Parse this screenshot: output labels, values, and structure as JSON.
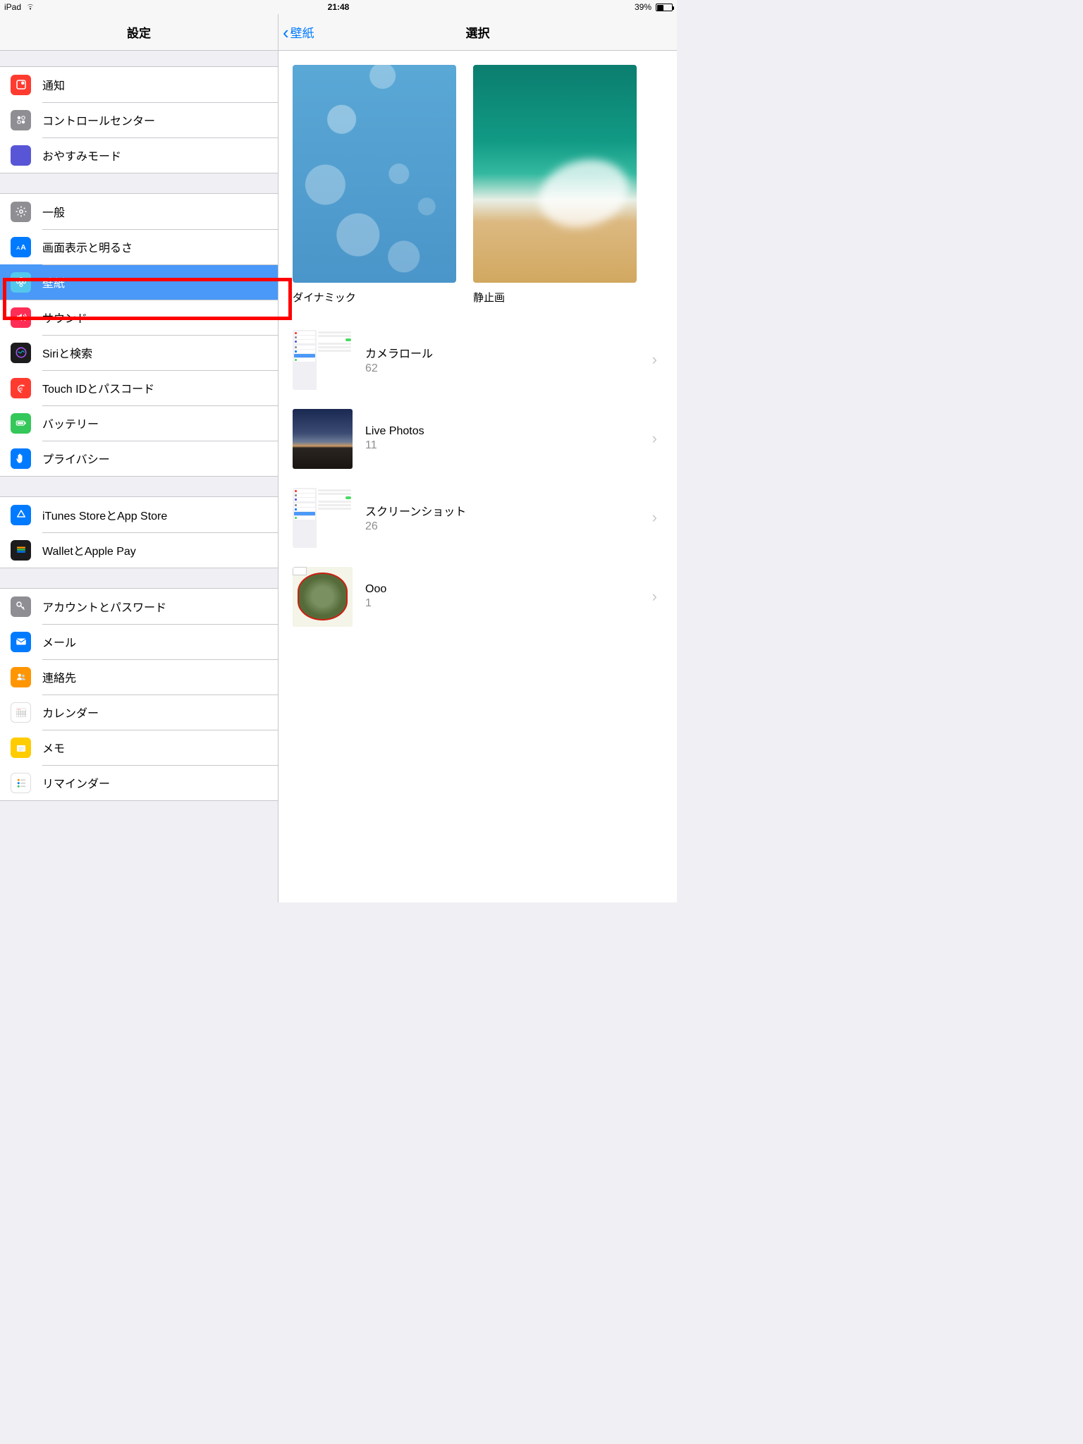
{
  "status": {
    "device": "iPad",
    "time": "21:48",
    "battery_pct": "39%",
    "battery_level": 0.39
  },
  "sidebar": {
    "title": "設定",
    "groups": [
      {
        "id": "g1",
        "items": [
          {
            "id": "notifications",
            "label": "通知",
            "icon": "notifications-icon",
            "color": "ic-red"
          },
          {
            "id": "control-center",
            "label": "コントロールセンター",
            "icon": "control-center-icon",
            "color": "ic-gray"
          },
          {
            "id": "dnd",
            "label": "おやすみモード",
            "icon": "moon-icon",
            "color": "ic-purple"
          }
        ]
      },
      {
        "id": "g2",
        "items": [
          {
            "id": "general",
            "label": "一般",
            "icon": "gear-icon",
            "color": "ic-gray2"
          },
          {
            "id": "display",
            "label": "画面表示と明るさ",
            "icon": "text-size-icon",
            "color": "ic-blue"
          },
          {
            "id": "wallpaper",
            "label": "壁紙",
            "icon": "flower-icon",
            "color": "ic-cyan",
            "selected": true
          },
          {
            "id": "sounds",
            "label": "サウンド",
            "icon": "speaker-icon",
            "color": "ic-pink"
          },
          {
            "id": "siri",
            "label": "Siriと検索",
            "icon": "siri-icon",
            "color": "ic-black"
          },
          {
            "id": "touchid",
            "label": "Touch IDとパスコード",
            "icon": "fingerprint-icon",
            "color": "ic-red"
          },
          {
            "id": "battery",
            "label": "バッテリー",
            "icon": "battery-icon",
            "color": "ic-green"
          },
          {
            "id": "privacy",
            "label": "プライバシー",
            "icon": "hand-icon",
            "color": "ic-bluedark"
          }
        ]
      },
      {
        "id": "g3",
        "items": [
          {
            "id": "itunes",
            "label": "iTunes StoreとApp Store",
            "icon": "appstore-icon",
            "color": "ic-blue"
          },
          {
            "id": "wallet",
            "label": "WalletとApple Pay",
            "icon": "wallet-icon",
            "color": "ic-black"
          }
        ]
      },
      {
        "id": "g4",
        "items": [
          {
            "id": "accounts",
            "label": "アカウントとパスワード",
            "icon": "key-icon",
            "color": "ic-gray"
          },
          {
            "id": "mail",
            "label": "メール",
            "icon": "mail-icon",
            "color": "ic-blue"
          },
          {
            "id": "contacts",
            "label": "連絡先",
            "icon": "contacts-icon",
            "color": "ic-orange"
          },
          {
            "id": "calendar",
            "label": "カレンダー",
            "icon": "calendar-icon",
            "color": "ic-white"
          },
          {
            "id": "notes",
            "label": "メモ",
            "icon": "notes-icon",
            "color": "ic-yellow"
          },
          {
            "id": "reminders",
            "label": "リマインダー",
            "icon": "reminders-icon",
            "color": "ic-white"
          }
        ]
      }
    ]
  },
  "detail": {
    "back_label": "壁紙",
    "title": "選択",
    "previews": [
      {
        "id": "dynamic",
        "label": "ダイナミック",
        "thumb": "thumb-dynamic"
      },
      {
        "id": "still",
        "label": "静止画",
        "thumb": "thumb-still"
      }
    ],
    "albums": [
      {
        "id": "camera-roll",
        "title": "カメラロール",
        "count": "62",
        "thumb": "thumb-screenshot-mini"
      },
      {
        "id": "live-photos",
        "title": "Live Photos",
        "count": "11",
        "thumb": "thumb-live"
      },
      {
        "id": "screenshots",
        "title": "スクリーンショット",
        "count": "26",
        "thumb": "thumb-screenshot-mini"
      },
      {
        "id": "ooo",
        "title": "Ooo",
        "count": "1",
        "thumb": "thumb-ooo"
      }
    ]
  }
}
